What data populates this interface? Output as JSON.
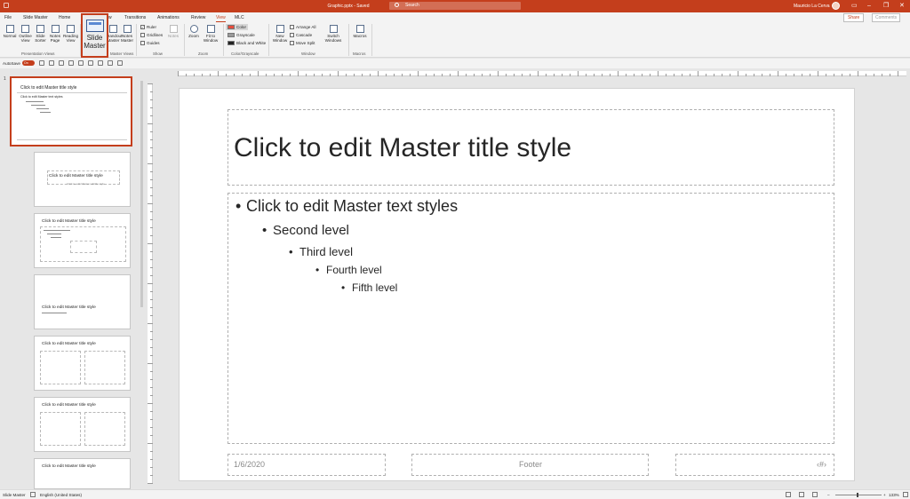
{
  "titlebar": {
    "doc_title": "Graphic.pptx - Saved",
    "search_placeholder": "Search",
    "user_name": "Mauricio La Cerva",
    "minimize": "–",
    "restore": "❐",
    "close": "✕"
  },
  "tabs": [
    "File",
    "Slide Master",
    "Home",
    "Insert",
    "Draw",
    "Transitions",
    "Animations",
    "Review",
    "View",
    "MLC"
  ],
  "active_tab": "View",
  "share_label": "Share",
  "comments_label": "Comments",
  "ribbon": {
    "presentation_views": [
      "Normal",
      "Outline View",
      "Slide Sorter",
      "Notes Page",
      "Reading View"
    ],
    "presentation_views_group": "Presentation Views",
    "master_views": {
      "slide_master_line1": "Slide",
      "slide_master_line2": "Master",
      "handout": "Handout Master",
      "notes": "Notes Master"
    },
    "master_views_group": "Master Views",
    "show": {
      "ruler": "Ruler",
      "gridlines": "Gridlines",
      "guides": "Guides",
      "notes": "Notes"
    },
    "show_group": "Show",
    "zoom": {
      "zoom": "Zoom",
      "fit": "Fit to Window"
    },
    "zoom_group": "Zoom",
    "color": {
      "color": "Color",
      "grayscale": "Grayscale",
      "bw": "Black and White"
    },
    "color_group": "Color/Grayscale",
    "window": {
      "new_window": "New Window",
      "arrange_all": "Arrange All",
      "cascade": "Cascade",
      "move_split": "Move Split",
      "switch_windows": "Switch Windows"
    },
    "window_group": "Window",
    "macros": "Macros",
    "macros_group": "Macros"
  },
  "qarow": {
    "autosave": "AutoSave",
    "toggle": "On"
  },
  "thumbnails": [
    {
      "num": "1",
      "title": "Click to edit Master title style",
      "body": "Click to edit Master text styles"
    },
    {
      "title": "Click to edit Master title style",
      "subtitle": "Click to edit Master subtitle style"
    },
    {
      "title": "Click to edit Master title style"
    },
    {
      "title": "Click to edit Master title style"
    },
    {
      "title": "Click to edit Master title style"
    },
    {
      "title": "Click to edit Master title style"
    },
    {
      "title": "Click to edit Master title style"
    }
  ],
  "slide": {
    "title": "Click to edit Master title style",
    "levels": [
      "Click to edit Master text styles",
      "Second level",
      "Third level",
      "Fourth level",
      "Fifth level"
    ],
    "date": "1/6/2020",
    "footer": "Footer",
    "slide_num": "‹#›"
  },
  "status": {
    "view": "Slide Master",
    "language": "English (United States)",
    "zoom": "133%"
  },
  "colors": {
    "accent": "#c43e1c",
    "chrome": "#f3f3f3",
    "workspace": "#e6e6e6"
  }
}
